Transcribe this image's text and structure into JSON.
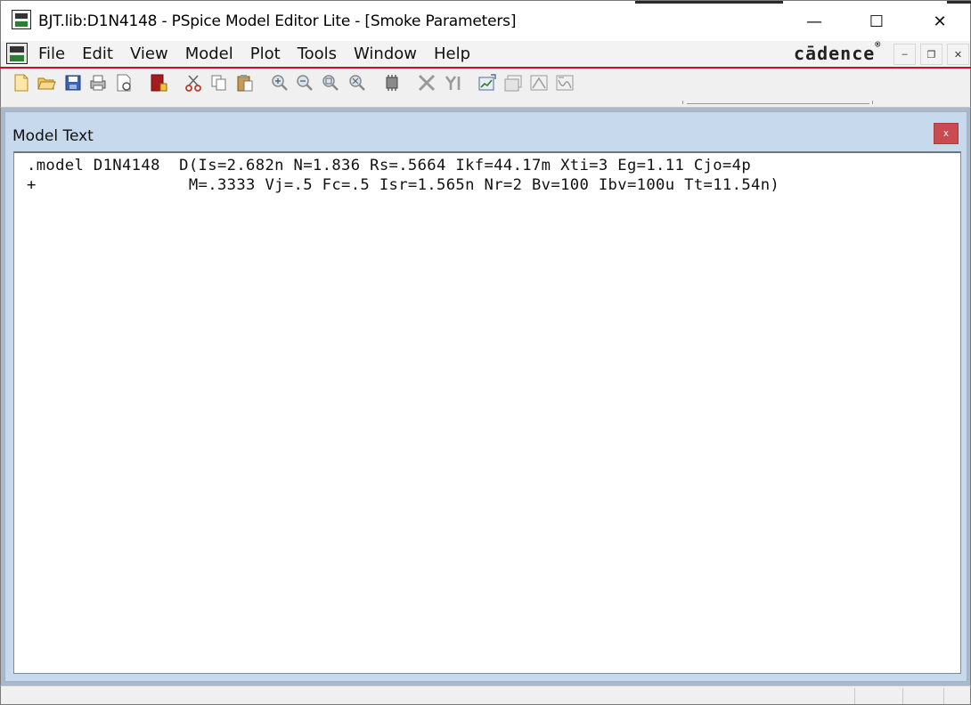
{
  "window": {
    "title": "BJT.lib:D1N4148 - PSpice Model Editor Lite  - [Smoke Parameters]",
    "minimize_glyph": "—",
    "maximize_glyph": "☐",
    "close_glyph": "✕"
  },
  "menu": {
    "items": [
      "File",
      "Edit",
      "View",
      "Model",
      "Plot",
      "Tools",
      "Window",
      "Help"
    ],
    "brand": "cādence",
    "brand_mark": "®",
    "mdi_minimize": "–",
    "mdi_restore": "❐",
    "mdi_close": "✕"
  },
  "toolbar": {
    "icons": [
      "new-file-icon",
      "open-folder-icon",
      "save-icon",
      "print-icon",
      "print-preview-icon",
      "library-book-icon",
      "cut-icon",
      "copy-icon",
      "paste-icon",
      "zoom-in-icon",
      "zoom-out-icon",
      "zoom-area-icon",
      "zoom-fit-icon",
      "chip-icon",
      "x-axis-icon",
      "y-axis-icon",
      "plot-chart-icon",
      "plot-window-icon",
      "plot-peak-icon",
      "plot-curve-icon"
    ]
  },
  "child_window": {
    "title": "Model Text",
    "close_glyph": "x"
  },
  "editor": {
    "lines": [
      ".model D1N4148  D(Is=2.682n N=1.836 Rs=.5664 Ikf=44.17m Xti=3 Eg=1.11 Cjo=4p",
      "+                M=.3333 Vj=.5 Fc=.5 Isr=1.565n Nr=2 Bv=100 Ibv=100u Tt=11.54n)"
    ]
  },
  "colors": {
    "accent_red": "#c8102e",
    "mdi_background": "#a9b8cc",
    "child_frame": "#c7d9ec",
    "child_close": "#c74b50"
  }
}
